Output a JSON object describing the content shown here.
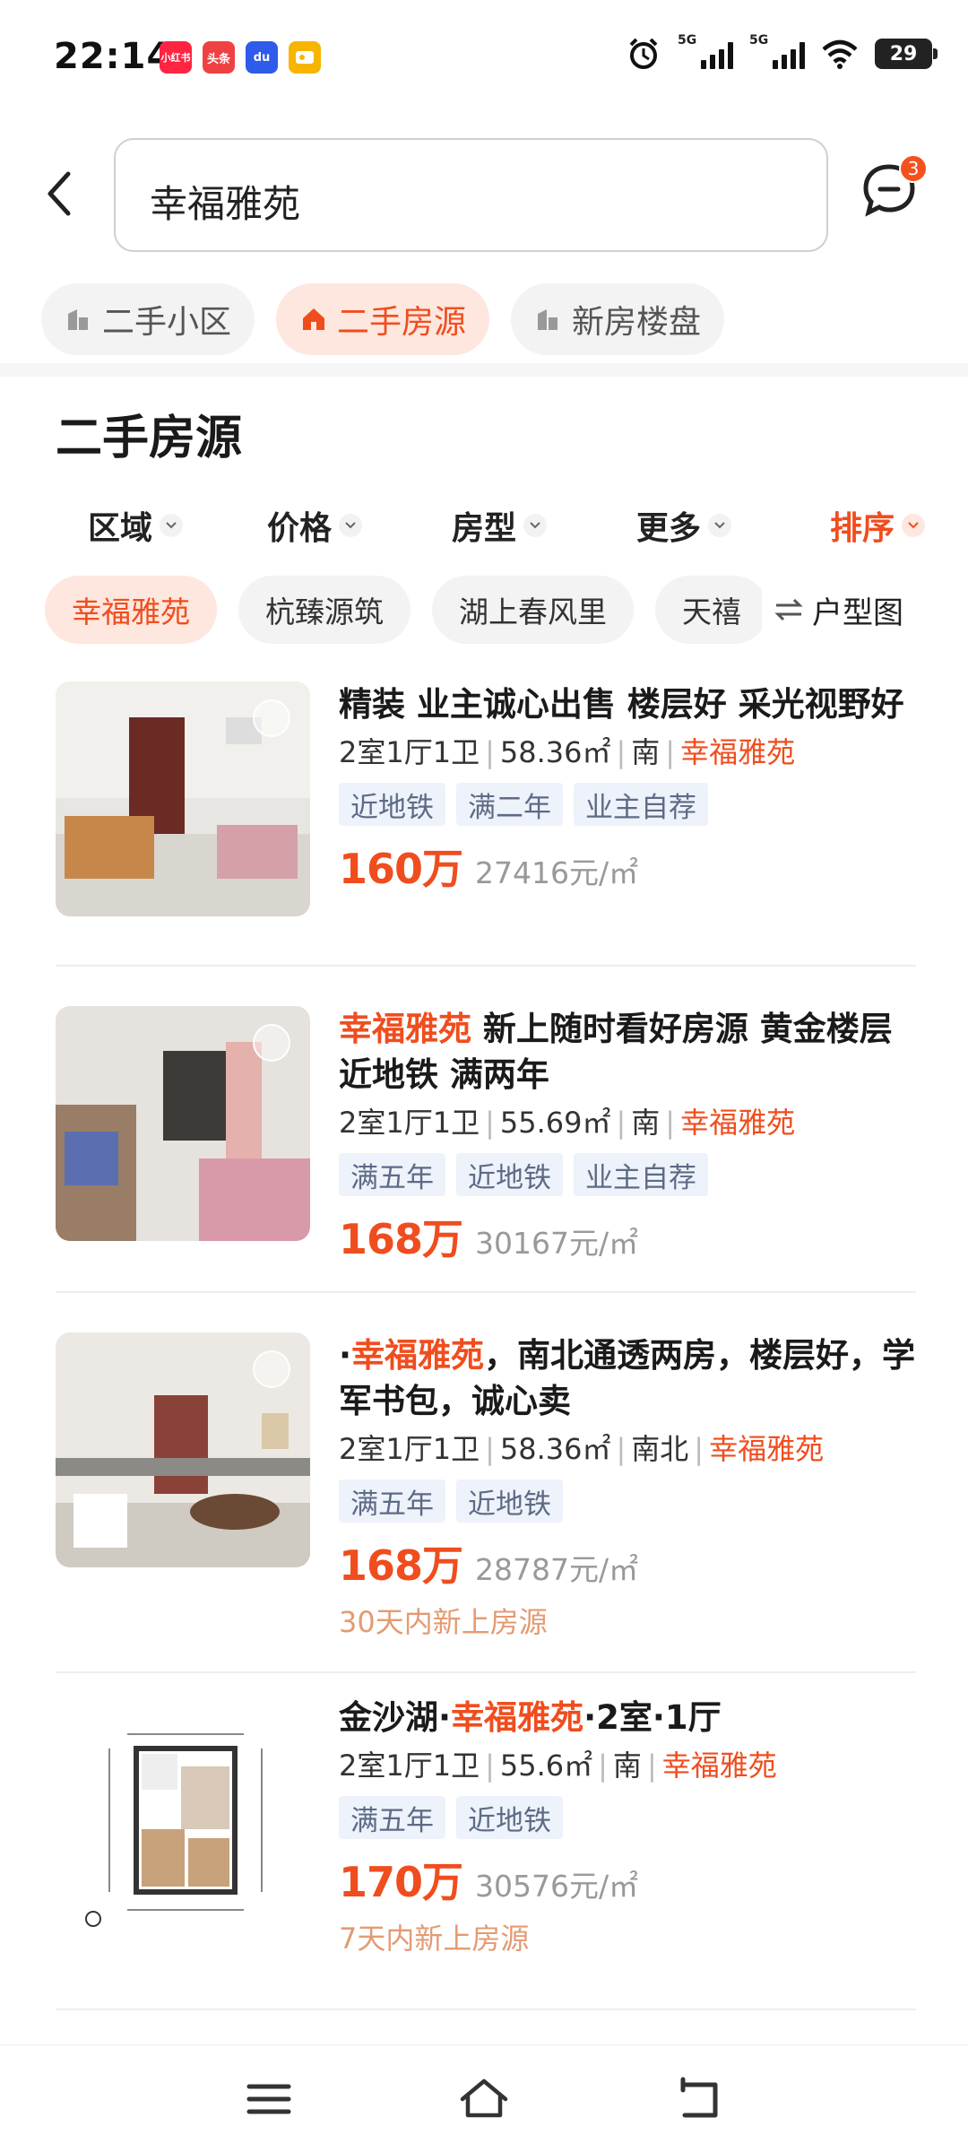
{
  "status_bar": {
    "time": "22:14",
    "apps": [
      {
        "name": "xiaohongshu",
        "label": "小红书",
        "color": "#ff2442"
      },
      {
        "name": "toutiao",
        "label": "头条",
        "color": "#f04142"
      },
      {
        "name": "baidu",
        "label": "du",
        "color": "#2f5bea"
      },
      {
        "name": "other-app",
        "label": "",
        "color": "#f7b500"
      }
    ],
    "signal1": "5G",
    "signal2": "5G",
    "battery": "29"
  },
  "search": {
    "query": "幸福雅苑",
    "message_badge": "3"
  },
  "categories": [
    {
      "label": "二手小区",
      "active": false
    },
    {
      "label": "二手房源",
      "active": true
    },
    {
      "label": "新房楼盘",
      "active": false
    }
  ],
  "section_title": "二手房源",
  "filters": [
    {
      "label": "区域"
    },
    {
      "label": "价格"
    },
    {
      "label": "房型"
    },
    {
      "label": "更多"
    },
    {
      "label": "排序"
    }
  ],
  "quick_tags": [
    "幸福雅苑",
    "杭臻源筑",
    "湖上春风里",
    "天禧"
  ],
  "floor_plan_label": "户型图",
  "listings": [
    {
      "title_prefix": "",
      "title_hl": "",
      "title_rest": "精装 业主诚心出售 楼层好 采光视野好",
      "layout": "2室1厅1卫",
      "area": "58.36㎡",
      "orientation": "南",
      "community": "幸福雅苑",
      "features": [
        "近地铁",
        "满二年",
        "业主自荐"
      ],
      "price": "160万",
      "unit_price": "27416元/㎡",
      "note": ""
    },
    {
      "title_prefix": "",
      "title_hl": "幸福雅苑",
      "title_rest": " 新上随时看好房源 黄金楼层  近地铁 满两年",
      "layout": "2室1厅1卫",
      "area": "55.69㎡",
      "orientation": "南",
      "community": "幸福雅苑",
      "features": [
        "满五年",
        "近地铁",
        "业主自荐"
      ],
      "price": "168万",
      "unit_price": "30167元/㎡",
      "note": ""
    },
    {
      "title_prefix": "·",
      "title_hl": "幸福雅苑",
      "title_rest": "，南北通透两房，楼层好，学军书包，诚心卖",
      "layout": "2室1厅1卫",
      "area": "58.36㎡",
      "orientation": "南北",
      "community": "幸福雅苑",
      "features": [
        "满五年",
        "近地铁"
      ],
      "price": "168万",
      "unit_price": "28787元/㎡",
      "note": "30天内新上房源"
    },
    {
      "title_prefix": "金沙湖·",
      "title_hl": "幸福雅苑",
      "title_rest": "·2室·1厅",
      "layout": "2室1厅1卫",
      "area": "55.6㎡",
      "orientation": "南",
      "community": "幸福雅苑",
      "features": [
        "满五年",
        "近地铁"
      ],
      "price": "170万",
      "unit_price": "30576元/㎡",
      "note": "7天内新上房源"
    }
  ],
  "colors": {
    "accent": "#f04d1e",
    "accent_bg": "#fde7de",
    "feature_bg": "#eef2fa",
    "feature_text": "#5d6b86",
    "note": "#e39b72"
  }
}
